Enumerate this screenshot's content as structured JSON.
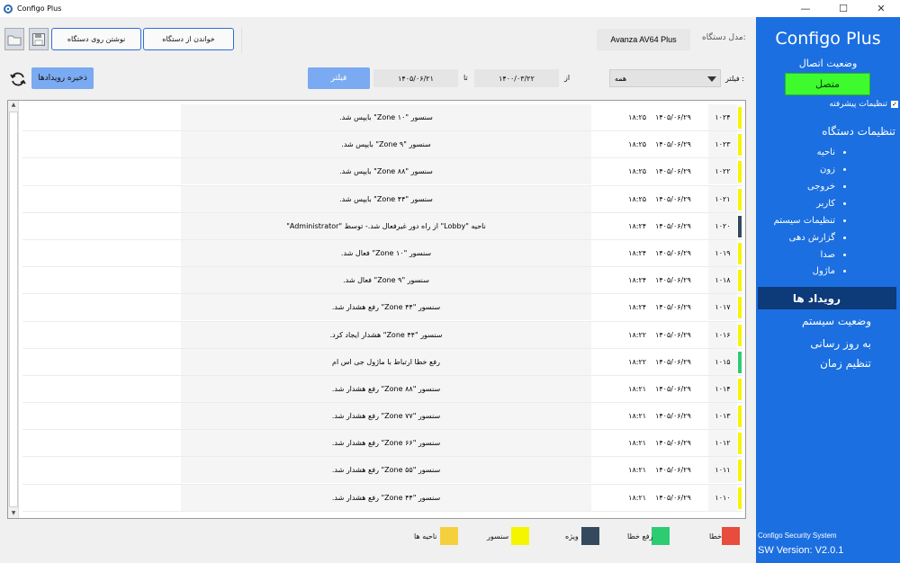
{
  "window": {
    "title": "Configo Plus",
    "minimize": "—",
    "maximize": "☐",
    "close": "✕"
  },
  "toolbar": {
    "read_from_device": "خواندن از دستگاه",
    "write_to_device": "نوشتن روی دستگاه",
    "device_label": "مدل دستگاه:",
    "device_model": "Avanza AV64 Plus"
  },
  "filter_bar": {
    "save_events": "ذخیره رویدادها",
    "filter_button": "فیلتر",
    "to_label": "تا",
    "to_date": "۱۴۰۵/۰۶/۲۱",
    "from_label": "از",
    "from_date": "۱۴۰۰/۰۳/۲۲",
    "filter_label": "فیلتر :",
    "filter_value": "همه"
  },
  "events": [
    {
      "id": "۱۰۲۴",
      "date": "۱۴۰۵/۰۶/۲۹",
      "time": "۱۸:۲۵",
      "message": "سنسور \"Zone ۱۰\" بایپس شد.",
      "color": "#f5f500"
    },
    {
      "id": "۱۰۲۳",
      "date": "۱۴۰۵/۰۶/۲۹",
      "time": "۱۸:۲۵",
      "message": "سنسور \"Zone ۹\" بایپس شد.",
      "color": "#f5f500"
    },
    {
      "id": "۱۰۲۲",
      "date": "۱۴۰۵/۰۶/۲۹",
      "time": "۱۸:۲۵",
      "message": "سنسور \"Zone ۸۸\" بایپس شد.",
      "color": "#f5f500"
    },
    {
      "id": "۱۰۲۱",
      "date": "۱۴۰۵/۰۶/۲۹",
      "time": "۱۸:۲۵",
      "message": "سنسور \"Zone ۴۴\" بایپس شد.",
      "color": "#f5f500"
    },
    {
      "id": "۱۰۲۰",
      "date": "۱۴۰۵/۰۶/۲۹",
      "time": "۱۸:۲۴",
      "message": "ناحیه \"Lobby\" از راه دور غیرفعال شد.- توسط \"Administrator\"",
      "color": "#34495e"
    },
    {
      "id": "۱۰۱۹",
      "date": "۱۴۰۵/۰۶/۲۹",
      "time": "۱۸:۲۴",
      "message": "سنسور \"Zone ۱۰\" فعال شد.",
      "color": "#f5f500"
    },
    {
      "id": "۱۰۱۸",
      "date": "۱۴۰۵/۰۶/۲۹",
      "time": "۱۸:۲۴",
      "message": "سنسور \"Zone ۹\" فعال شد.",
      "color": "#f5f500"
    },
    {
      "id": "۱۰۱۷",
      "date": "۱۴۰۵/۰۶/۲۹",
      "time": "۱۸:۲۴",
      "message": "سنسور \"Zone ۴۴\" رفع هشدار شد.",
      "color": "#f5f500"
    },
    {
      "id": "۱۰۱۶",
      "date": "۱۴۰۵/۰۶/۲۹",
      "time": "۱۸:۲۲",
      "message": "سنسور \"Zone ۴۴\" هشدار ایجاد کرد.",
      "color": "#f5f500"
    },
    {
      "id": "۱۰۱۵",
      "date": "۱۴۰۵/۰۶/۲۹",
      "time": "۱۸:۲۲",
      "message": "رفع خطا ارتباط با ماژول جی اس ام",
      "color": "#2ecc71"
    },
    {
      "id": "۱۰۱۴",
      "date": "۱۴۰۵/۰۶/۲۹",
      "time": "۱۸:۲۱",
      "message": "سنسور \"Zone ۸۸\" رفع هشدار شد.",
      "color": "#f5f500"
    },
    {
      "id": "۱۰۱۳",
      "date": "۱۴۰۵/۰۶/۲۹",
      "time": "۱۸:۲۱",
      "message": "سنسور \"Zone ۷۷\" رفع هشدار شد.",
      "color": "#f5f500"
    },
    {
      "id": "۱۰۱۲",
      "date": "۱۴۰۵/۰۶/۲۹",
      "time": "۱۸:۲۱",
      "message": "سنسور \"Zone ۶۶\" رفع هشدار شد.",
      "color": "#f5f500"
    },
    {
      "id": "۱۰۱۱",
      "date": "۱۴۰۵/۰۶/۲۹",
      "time": "۱۸:۲۱",
      "message": "سنسور \"Zone ۵۵\" رفع هشدار شد.",
      "color": "#f5f500"
    },
    {
      "id": "۱۰۱۰",
      "date": "۱۴۰۵/۰۶/۲۹",
      "time": "۱۸:۲۱",
      "message": "سنسور \"Zone ۴۴\" رفع هشدار شد.",
      "color": "#f5f500"
    }
  ],
  "legend": [
    {
      "label": "خطا",
      "color": "#e74c3c"
    },
    {
      "label": "رفع خطا",
      "color": "#2ecc71"
    },
    {
      "label": "ویژه",
      "color": "#34495e"
    },
    {
      "label": "سنسور",
      "color": "#f5f500"
    },
    {
      "label": "ناحیه ها",
      "color": "#f4d03f"
    }
  ],
  "sidebar": {
    "brand": "Configo Plus",
    "connection_title": "وضعیت اتصال",
    "connection_status": "متصل",
    "advanced_settings": "تنظیمات پیشرفته",
    "device_settings": "تنظیمات دستگاه",
    "items": [
      "ناحیه",
      "زون",
      "خروجی",
      "کاربر",
      "تنظیمات سیستم",
      "گزارش دهی",
      "صدا",
      "ماژول"
    ],
    "events": "رویداد ها",
    "system_status": "وضعیت سیستم",
    "update": "به روز رسانی",
    "time_settings": "تنظیم زمان",
    "company": "Configo Security System",
    "version": "SW Version: V2.0.1"
  }
}
